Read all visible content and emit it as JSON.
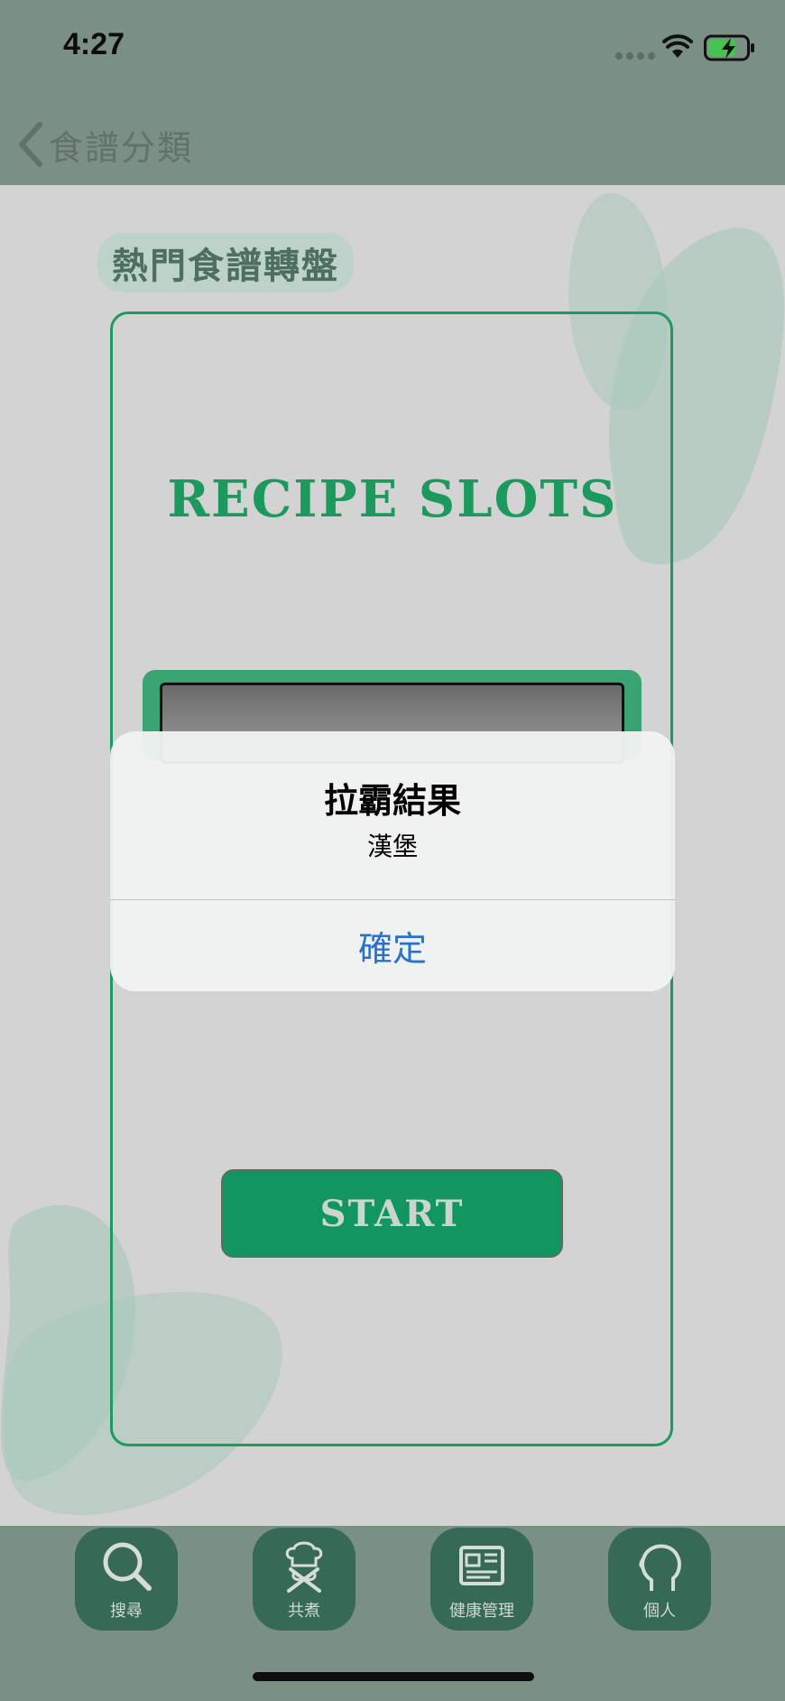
{
  "status_bar": {
    "time": "4:27",
    "wifi_icon": "wifi-icon",
    "battery_icon": "battery-charging-icon"
  },
  "nav": {
    "back_label": "食譜分類",
    "back_icon": "chevron-left-icon"
  },
  "page": {
    "section_title": "熱門食譜轉盤",
    "slots_title": "RECIPE SLOTS",
    "start_label": "START"
  },
  "alert": {
    "title": "拉霸結果",
    "message": "漢堡",
    "ok_label": "確定"
  },
  "tabs": [
    {
      "label": "搜尋",
      "icon": "search-icon"
    },
    {
      "label": "共煮",
      "icon": "chef-utensils-icon"
    },
    {
      "label": "健康管理",
      "icon": "newspaper-icon"
    },
    {
      "label": "個人",
      "icon": "head-profile-icon"
    }
  ],
  "colors": {
    "bar_background": "#7a9085",
    "accent_green": "#1c9a5e",
    "tab_button": "#376a56",
    "alert_link": "#2a72c9"
  }
}
